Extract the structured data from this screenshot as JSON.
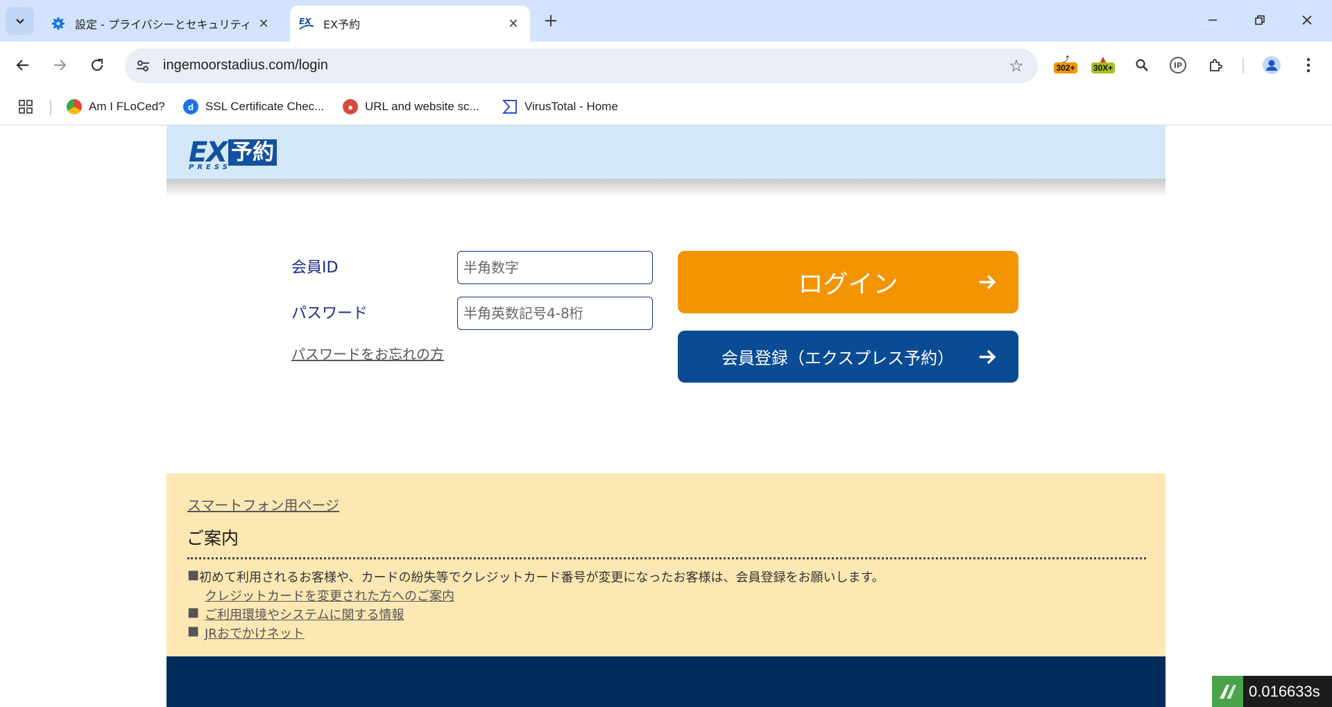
{
  "browser": {
    "tabs": [
      {
        "title": "設定 - プライバシーとセキュリティ",
        "icon": "gear-icon"
      },
      {
        "title": "EX予約",
        "icon": "ex-favicon"
      }
    ],
    "window_controls": {
      "minimize": "—",
      "restore": "❐",
      "close": "✕"
    },
    "url": "ingemoorstadius.com/login",
    "extensions": {
      "badge1": "302+",
      "badge2": "30X+",
      "ip_label": "IP"
    },
    "bookmarks": [
      {
        "label": "Am I FLoCed?"
      },
      {
        "label": "SSL Certificate Chec..."
      },
      {
        "label": "URL and website sc..."
      },
      {
        "label": "VirusTotal - Home"
      }
    ]
  },
  "site": {
    "logo": {
      "ex": "EX",
      "yoyaku": "予約",
      "press": "PRESS"
    },
    "login_form": {
      "member_id_label": "会員ID",
      "member_id_placeholder": "半角数字",
      "password_label": "パスワード",
      "password_placeholder": "半角英数記号4-8桁",
      "forgot_link": "パスワードをお忘れの方",
      "login_button": "ログイン",
      "register_button": "会員登録（エクスプレス予約）"
    },
    "info": {
      "smartphone_link": "スマートフォン用ページ",
      "title": "ご案内",
      "bullet": "■",
      "notice_text": "初めて利用されるお客様や、カードの紛失等でクレジットカード番号が変更になったお客様は、会員登録をお願いします。",
      "credit_card_link": "クレジットカードを変更された方へのご案内",
      "environment_link": "ご利用環境やシステムに関する情報",
      "jr_link": "JRおでかけネット"
    }
  },
  "overlay": {
    "timer": "0.016633s"
  },
  "colors": {
    "login_button": "#f29400",
    "register_button": "#0a4b94",
    "header_bg": "#d4e8f9",
    "info_bg": "#fde8b4",
    "footer_bg": "#012d5c"
  }
}
